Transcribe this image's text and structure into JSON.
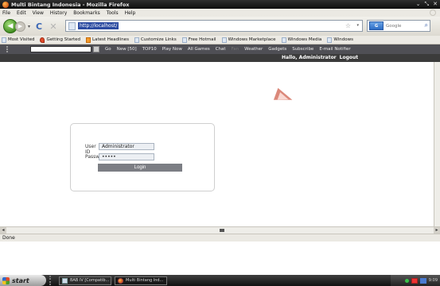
{
  "window": {
    "title": "Multi Bintang Indonesia - Mozilla Firefox",
    "controls": [
      "⌄",
      "⤡",
      "✕"
    ]
  },
  "menu": {
    "items": [
      "File",
      "Edit",
      "View",
      "History",
      "Bookmarks",
      "Tools",
      "Help"
    ],
    "accels": [
      "F",
      "E",
      "V",
      "s",
      "B",
      "T",
      "H"
    ]
  },
  "navigation": {
    "url": "http://localhost/",
    "search_placeholder": "Google",
    "search_engine": "G"
  },
  "bookmarks": [
    {
      "label": "Most Visited",
      "icon": "folder-icon"
    },
    {
      "label": "Getting Started",
      "icon": "firefox-icon"
    },
    {
      "label": "Latest Headlines",
      "icon": "rss-icon"
    },
    {
      "label": "Customize Links",
      "icon": "page-icon"
    },
    {
      "label": "Free Hotmail",
      "icon": "page-icon"
    },
    {
      "label": "Windows Marketplace",
      "icon": "page-icon"
    },
    {
      "label": "Windows Media",
      "icon": "page-icon"
    },
    {
      "label": "Windows",
      "icon": "page-icon"
    }
  ],
  "toolbar2": {
    "items": [
      "Go",
      "New [50]",
      "TOP10",
      "Play Now",
      "All Games",
      "Chat",
      "Fan",
      "Weather",
      "Gadgets",
      "Subscribe",
      "E-mail Notifier"
    ]
  },
  "header": {
    "greeting": "Hallo, Administrator",
    "logout": "Logout"
  },
  "login": {
    "userid_label": "User ID",
    "userid_value": "Administrator",
    "password_label": "Password",
    "password_value": "•••••",
    "button": "Login"
  },
  "status": {
    "text": "Done"
  },
  "taskbar": {
    "start": "start",
    "tasks": [
      {
        "label": "BAB IV [Compatib...",
        "icon": "word-doc-icon"
      },
      {
        "label": "Multi Bintang Ind...",
        "icon": "firefox-icon"
      }
    ],
    "clock": "9:09"
  },
  "colors": {
    "greet_bar": "#3b3b3b",
    "login_button": "#7c7e84",
    "cursor": "#d77b6c"
  }
}
